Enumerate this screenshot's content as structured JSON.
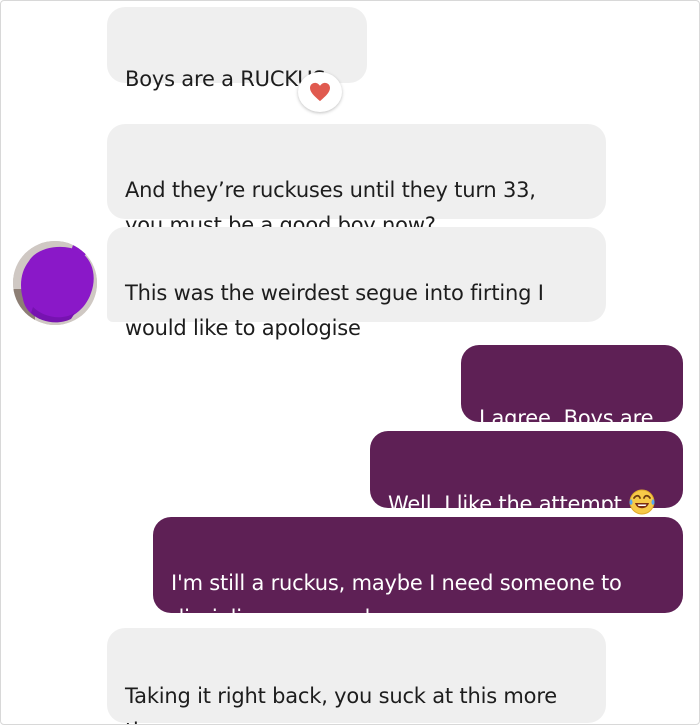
{
  "conversation": {
    "messages": [
      {
        "direction": "received",
        "text": "Boys are a RUCKUS"
      },
      {
        "direction": "received",
        "text": "And they’re ruckuses until they turn 33,\nyou must be a good boy now?"
      },
      {
        "direction": "received",
        "text": "This was the weirdest segue into firting I\nwould like to apologise"
      },
      {
        "direction": "sent",
        "text": "I agree. Boys are."
      },
      {
        "direction": "sent",
        "text": "Well, I like the attempt",
        "emoji": "face-with-tears-of-joy-icon"
      },
      {
        "direction": "sent",
        "text": "I'm still a ruckus, maybe I need someone to\ndiscipline me, you know."
      },
      {
        "direction": "received",
        "text": "Taking it right back, you suck at this more\nthan me"
      }
    ],
    "reaction": {
      "icon": "heart-icon",
      "color": "#e05a4f"
    },
    "avatar": {
      "description_icon": "redacted-avatar-icon",
      "scribble_color": "#8a18c8"
    }
  },
  "colors": {
    "received_bubble": "#efefef",
    "sent_bubble": "#5e2055",
    "received_text": "#1d1d1d",
    "sent_text": "#ffffff"
  }
}
